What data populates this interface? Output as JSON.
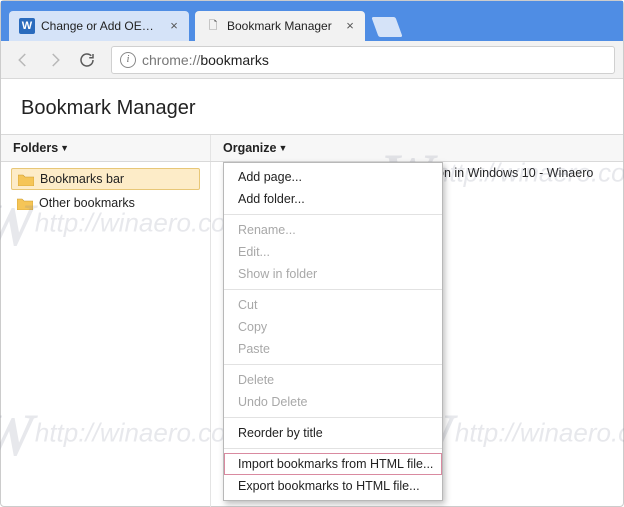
{
  "tabs": [
    {
      "title": "Change or Add OEM Sup",
      "favicon": "W",
      "active": false
    },
    {
      "title": "Bookmark Manager",
      "favicon": "",
      "active": true
    }
  ],
  "omnibox": {
    "protocol": "chrome://",
    "path": "bookmarks"
  },
  "page": {
    "title": "Bookmark Manager"
  },
  "columns": {
    "left": "Folders",
    "right": "Organize"
  },
  "sidebar": {
    "folders": [
      {
        "label": "Bookmarks bar",
        "selected": true
      },
      {
        "label": "Other bookmarks",
        "selected": false
      }
    ]
  },
  "peek_item": "on in Windows 10 - Winaero",
  "organize_menu": [
    {
      "label": "Add page...",
      "enabled": true
    },
    {
      "label": "Add folder...",
      "enabled": true
    },
    {
      "sep": true
    },
    {
      "label": "Rename...",
      "enabled": false
    },
    {
      "label": "Edit...",
      "enabled": false
    },
    {
      "label": "Show in folder",
      "enabled": false
    },
    {
      "sep": true
    },
    {
      "label": "Cut",
      "enabled": false
    },
    {
      "label": "Copy",
      "enabled": false
    },
    {
      "label": "Paste",
      "enabled": false
    },
    {
      "sep": true
    },
    {
      "label": "Delete",
      "enabled": false
    },
    {
      "label": "Undo Delete",
      "enabled": false
    },
    {
      "sep": true
    },
    {
      "label": "Reorder by title",
      "enabled": true
    },
    {
      "sep": true
    },
    {
      "label": "Import bookmarks from HTML file...",
      "enabled": true,
      "highlighted": true
    },
    {
      "label": "Export bookmarks to HTML file...",
      "enabled": true
    }
  ],
  "watermark": "http://winaero.com"
}
